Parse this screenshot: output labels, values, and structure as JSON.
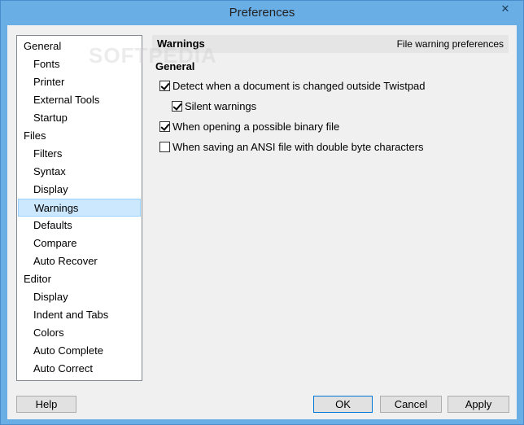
{
  "window": {
    "title": "Preferences",
    "close_glyph": "✕"
  },
  "watermark": "SOFTPEDIA",
  "nav": {
    "items": [
      {
        "label": "General",
        "level": "cat"
      },
      {
        "label": "Fonts",
        "level": "sub"
      },
      {
        "label": "Printer",
        "level": "sub"
      },
      {
        "label": "External Tools",
        "level": "sub"
      },
      {
        "label": "Startup",
        "level": "sub"
      },
      {
        "label": "Files",
        "level": "cat"
      },
      {
        "label": "Filters",
        "level": "sub"
      },
      {
        "label": "Syntax",
        "level": "sub"
      },
      {
        "label": "Display",
        "level": "sub"
      },
      {
        "label": "Warnings",
        "level": "sub",
        "selected": true
      },
      {
        "label": "Defaults",
        "level": "sub"
      },
      {
        "label": "Compare",
        "level": "sub"
      },
      {
        "label": "Auto Recover",
        "level": "sub"
      },
      {
        "label": "Editor",
        "level": "cat"
      },
      {
        "label": "Display",
        "level": "sub"
      },
      {
        "label": "Indent and Tabs",
        "level": "sub"
      },
      {
        "label": "Colors",
        "level": "sub"
      },
      {
        "label": "Auto Complete",
        "level": "sub"
      },
      {
        "label": "Auto Correct",
        "level": "sub"
      }
    ]
  },
  "panel": {
    "header_title": "Warnings",
    "header_desc": "File warning preferences",
    "section_title": "General",
    "options": [
      {
        "label": "Detect when a document is changed outside Twistpad",
        "checked": true
      },
      {
        "label": "Silent warnings",
        "checked": true
      },
      {
        "label": "When opening a possible binary file",
        "checked": true
      },
      {
        "label": "When saving an ANSI file with double byte characters",
        "checked": false
      }
    ]
  },
  "buttons": {
    "help": "Help",
    "ok": "OK",
    "cancel": "Cancel",
    "apply": "Apply"
  }
}
